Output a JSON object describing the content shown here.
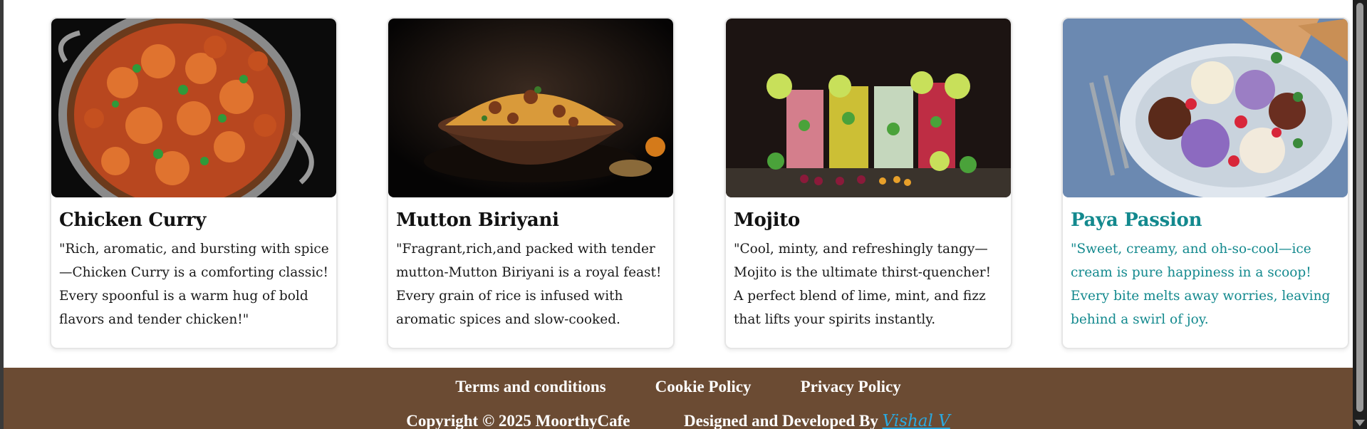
{
  "cards": [
    {
      "title": "Chicken Curry",
      "description": "\"Rich, aromatic, and bursting with spice—Chicken Curry is a comforting classic! Every spoonful is a warm hug of bold flavors and tender chicken!\"",
      "image": "chicken-curry-photo"
    },
    {
      "title": "Mutton Biriyani",
      "description": "\"Fragrant,rich,and packed with tender mutton-Mutton Biriyani is a royal feast! Every grain of rice is infused with aromatic spices and slow-cooked.",
      "image": "mutton-biriyani-photo"
    },
    {
      "title": "Mojito",
      "description": "\"Cool, minty, and refreshingly tangy—Mojito is the ultimate thirst-quencher! A perfect blend of lime, mint, and fizz that lifts your spirits instantly.",
      "image": "mojito-photo"
    },
    {
      "title": "Paya Passion",
      "description": "\"Sweet, creamy, and oh-so-cool—ice cream is pure happiness in a scoop! Every bite melts away worries, leaving behind a swirl of joy.",
      "image": "ice-cream-photo"
    }
  ],
  "footer": {
    "links": [
      "Terms and conditions",
      "Cookie Policy",
      "Privacy Policy"
    ],
    "copyright": "Copyright © 2025 MoorthyCafe",
    "designed_by": "Designed and Developed By",
    "developer": "Vishal V"
  },
  "colors": {
    "footer_bg": "#6b4b33",
    "hover_accent": "#13898e",
    "developer_link": "#2aa9e0"
  }
}
